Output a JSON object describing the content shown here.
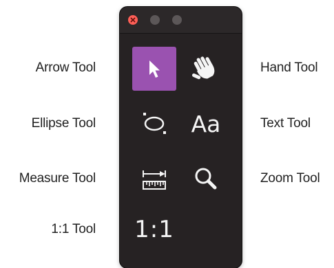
{
  "callouts": {
    "arrow": "Arrow Tool",
    "hand": "Hand Tool",
    "ellipse": "Ellipse Tool",
    "text": "Text Tool",
    "measure": "Measure Tool",
    "zoom": "Zoom Tool",
    "ratio": "1:1 Tool"
  },
  "palette": {
    "selected_tool": "arrow",
    "text_tool_glyph": "Aa",
    "ratio_tool_glyph": "1:1"
  },
  "icons": {
    "arrow": "arrow-cursor-icon",
    "hand": "hand-icon",
    "ellipse": "ellipse-icon",
    "text": "text-icon",
    "measure": "ruler-measure-icon",
    "zoom": "magnifier-icon",
    "ratio": "one-to-one-icon"
  },
  "colors": {
    "palette_background": "#262223",
    "selected_tool": "#9a52b0",
    "close_button": "#fe5f57"
  }
}
